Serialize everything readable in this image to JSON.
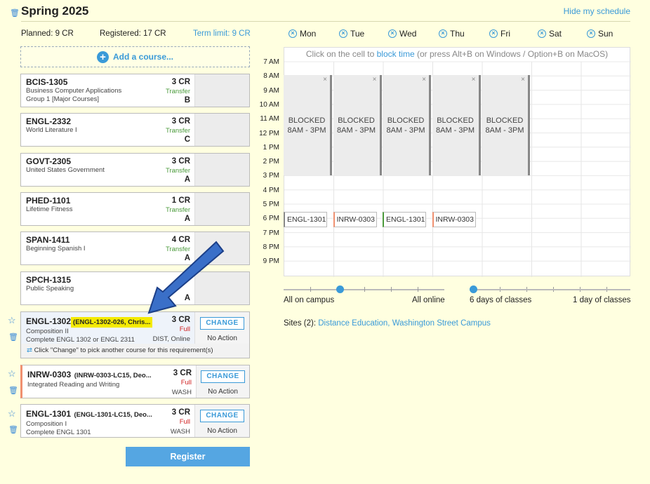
{
  "header": {
    "title": "Spring 2025",
    "hide_link": "Hide my schedule"
  },
  "stats": {
    "planned": "Planned: 9 CR",
    "registered": "Registered: 17 CR",
    "term_limit": "Term limit: 9 CR"
  },
  "add_course": "Add a course...",
  "registered_courses": [
    {
      "code": "BCIS-1305",
      "name": "Business Computer Applications",
      "detail": "Group 1 [Major Courses]",
      "credits": "3 CR",
      "status": "Transfer",
      "grade": "B"
    },
    {
      "code": "ENGL-2332",
      "name": "World Literature I",
      "detail": "",
      "credits": "3 CR",
      "status": "Transfer",
      "grade": "C"
    },
    {
      "code": "GOVT-2305",
      "name": "United States Government",
      "detail": "",
      "credits": "3 CR",
      "status": "Transfer",
      "grade": "A"
    },
    {
      "code": "PHED-1101",
      "name": "Lifetime Fitness",
      "detail": "",
      "credits": "1 CR",
      "status": "Transfer",
      "grade": "A"
    },
    {
      "code": "SPAN-1411",
      "name": "Beginning Spanish I",
      "detail": "",
      "credits": "4 CR",
      "status": "Transfer",
      "grade": "A"
    },
    {
      "code": "SPCH-1315",
      "name": "Public Speaking",
      "detail": "",
      "credits": "",
      "status": "",
      "grade": "A"
    }
  ],
  "planned_courses": [
    {
      "code": "ENGL-1302",
      "section": "(ENGL-1302-026, Chris...",
      "name": "Composition II",
      "detail": "Complete ENGL 1302 or ENGL 2311",
      "credits": "3 CR",
      "status": "Full",
      "location": "DIST, Online",
      "change": "CHANGE",
      "action": "No Action"
    },
    {
      "code": "INRW-0303",
      "section": "(INRW-0303-LC15, Deo...",
      "name": "Integrated Reading and Writing",
      "detail": "",
      "credits": "3 CR",
      "status": "Full",
      "location": "WASH",
      "change": "CHANGE",
      "action": "No Action"
    },
    {
      "code": "ENGL-1301",
      "section": "(ENGL-1301-LC15, Deo...",
      "name": "Composition I",
      "detail": "Complete ENGL 1301",
      "credits": "3 CR",
      "status": "Full",
      "location": "WASH",
      "change": "CHANGE",
      "action": "No Action"
    }
  ],
  "change_hint": "Click \"Change\" to pick another course for this requirement(s)",
  "register_button": "Register",
  "days": [
    "Mon",
    "Tue",
    "Wed",
    "Thu",
    "Fri",
    "Sat",
    "Sun"
  ],
  "calendar": {
    "instruction_pre": "Click on the cell to ",
    "instruction_link": "block time",
    "instruction_post": " (or press Alt+B on Windows / Option+B on MacOS)",
    "hours": [
      "7 AM",
      "8 AM",
      "9 AM",
      "10 AM",
      "11 AM",
      "12 PM",
      "1 PM",
      "2 PM",
      "3 PM",
      "4 PM",
      "5 PM",
      "6 PM",
      "7 PM",
      "8 PM",
      "9 PM"
    ],
    "blocked_label": "BLOCKED",
    "blocked_range": "8AM - 3PM",
    "events": [
      "ENGL-1301",
      "INRW-0303",
      "ENGL-1301",
      "INRW-0303"
    ]
  },
  "sliders": {
    "campus_left": "All on campus",
    "campus_right": "All online",
    "campus_value_fraction": 0.35,
    "days_left": "6 days of classes",
    "days_right": "1 day of classes",
    "days_value_fraction": 0.0
  },
  "sites": {
    "label": "Sites (2): ",
    "value": "Distance Education, Washington Street Campus"
  },
  "colors": {
    "accent": "#3a9ad8",
    "highlight": "#f4ea00",
    "arrow": "#3a6fc8",
    "background": "#ffffe0"
  }
}
